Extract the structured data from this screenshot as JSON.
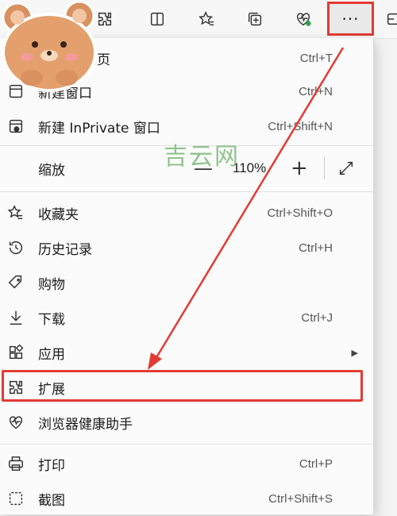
{
  "toolbar": {
    "more_label": "···",
    "icons": [
      "extensions-icon",
      "split-screen-icon",
      "favorites-icon",
      "collections-icon",
      "browser-essentials-icon",
      "more-icon",
      "tab-actions-icon"
    ]
  },
  "menu": {
    "new_tab": {
      "label": "页",
      "shortcut": "Ctrl+T"
    },
    "new_window": {
      "label": "新建窗口",
      "shortcut": "Ctrl+N"
    },
    "new_inprivate": {
      "label": "新建 InPrivate 窗口",
      "shortcut": "Ctrl+Shift+N"
    },
    "zoom": {
      "label": "缩放",
      "minus": "—",
      "value": "110%",
      "plus": "+"
    },
    "favorites": {
      "label": "收藏夹",
      "shortcut": "Ctrl+Shift+O"
    },
    "history": {
      "label": "历史记录",
      "shortcut": "Ctrl+H"
    },
    "shopping": {
      "label": "购物"
    },
    "downloads": {
      "label": "下载",
      "shortcut": "Ctrl+J"
    },
    "apps": {
      "label": "应用",
      "chevron": "▶"
    },
    "extensions": {
      "label": "扩展"
    },
    "browser_essentials": {
      "label": "浏览器健康助手"
    },
    "print": {
      "label": "打印",
      "shortcut": "Ctrl+P"
    },
    "screenshot": {
      "label": "截图",
      "shortcut": "Ctrl+Shift+S"
    }
  },
  "watermark": "吉云网",
  "colors": {
    "highlight": "#e23b33",
    "watermark": "#7dbb7a"
  }
}
